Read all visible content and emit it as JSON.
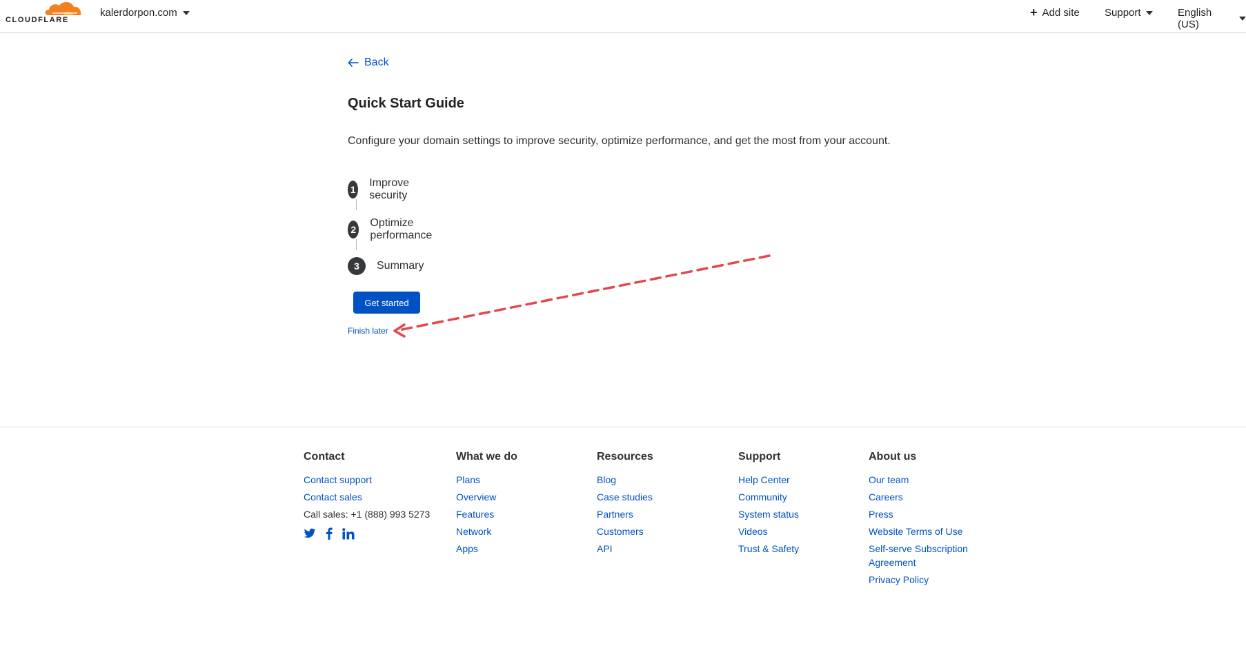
{
  "header": {
    "logo_text": "CLOUDFLARE",
    "zone": "kalerdorpon.com",
    "add_site": "Add site",
    "support": "Support",
    "language": "English (US)"
  },
  "main": {
    "back_label": "Back",
    "title": "Quick Start Guide",
    "description": "Configure your domain settings to improve security, optimize performance, and get the most from your account.",
    "steps": [
      {
        "num": "1",
        "label": "Improve security"
      },
      {
        "num": "2",
        "label": "Optimize performance"
      },
      {
        "num": "3",
        "label": "Summary"
      }
    ],
    "get_started": "Get started",
    "finish_later": "Finish later"
  },
  "footer": {
    "columns": [
      {
        "title": "Contact",
        "links": [
          "Contact support",
          "Contact sales"
        ],
        "static": "Call sales: +1 (888) 993 5273",
        "social": [
          "twitter-icon",
          "facebook-icon",
          "linkedin-icon"
        ]
      },
      {
        "title": "What we do",
        "links": [
          "Plans",
          "Overview",
          "Features",
          "Network",
          "Apps"
        ]
      },
      {
        "title": "Resources",
        "links": [
          "Blog",
          "Case studies",
          "Partners",
          "Customers",
          "API"
        ]
      },
      {
        "title": "Support",
        "links": [
          "Help Center",
          "Community",
          "System status",
          "Videos",
          "Trust & Safety"
        ]
      },
      {
        "title": "About us",
        "links": [
          "Our team",
          "Careers",
          "Press",
          "Website Terms of Use",
          "Self-serve Subscription",
          "Agreement",
          "Privacy Policy"
        ]
      }
    ]
  },
  "colors": {
    "accent": "#0051c3",
    "brand_orange": "#f38020",
    "annotation": "#e5474b"
  }
}
